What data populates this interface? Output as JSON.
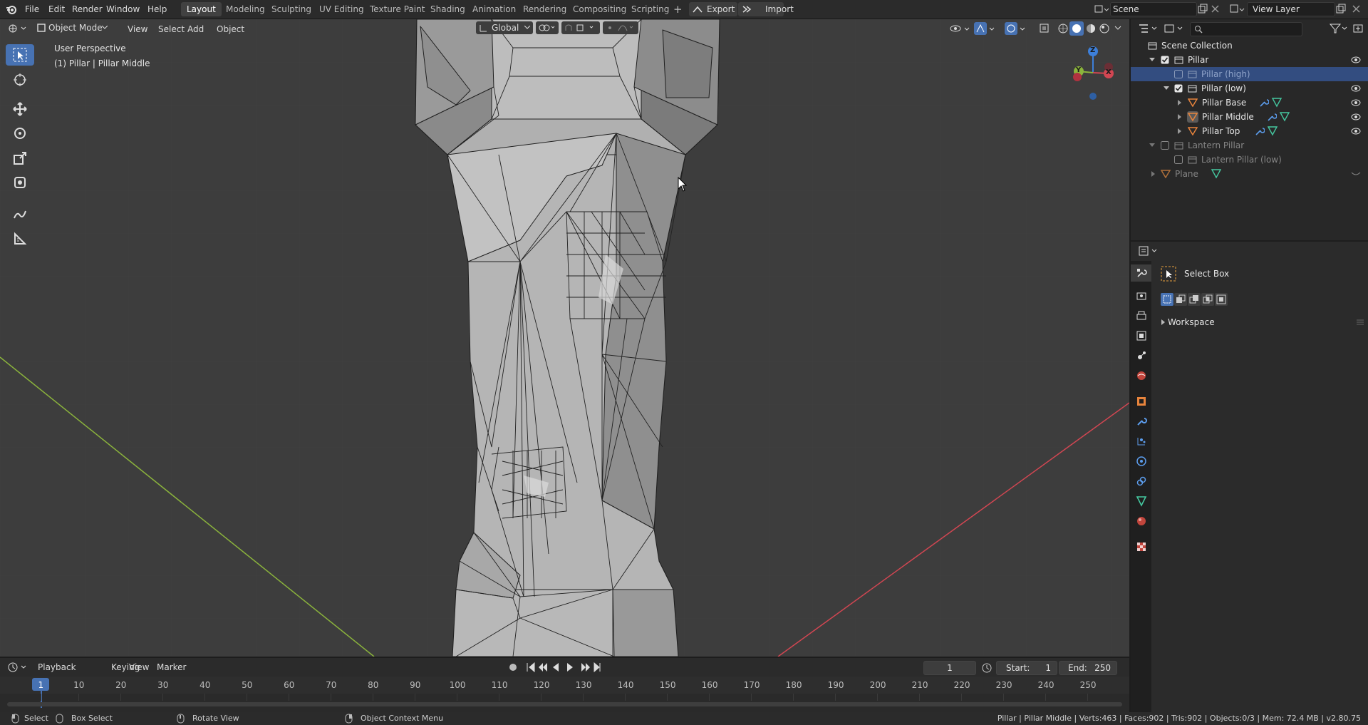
{
  "topbar": {
    "menus": [
      "File",
      "Edit",
      "Render",
      "Window",
      "Help"
    ],
    "workspaces": [
      "Layout",
      "Modeling",
      "Sculpting",
      "UV Editing",
      "Texture Paint",
      "Shading",
      "Animation",
      "Rendering",
      "Compositing",
      "Scripting"
    ],
    "add_tab": "+",
    "export_label": "Export",
    "import_label": "Import",
    "scene_name": "Scene",
    "view_layer": "View Layer"
  },
  "viewport": {
    "mode": "Object Mode",
    "menus": [
      "View",
      "Select",
      "Add",
      "Object"
    ],
    "orientation": "Global",
    "perspective_label": "User Perspective",
    "active_object_label": "(1) Pillar | Pillar Middle",
    "gizmo": {
      "z": "Z",
      "y": "Y",
      "x": "X"
    }
  },
  "timeline": {
    "menus": [
      "Playback",
      "Keying",
      "View",
      "Marker"
    ],
    "current_frame": "1",
    "start_label": "Start:",
    "start_value": "1",
    "end_label": "End:",
    "end_value": "250",
    "frame_marks": [
      "1",
      "10",
      "20",
      "30",
      "40",
      "50",
      "60",
      "70",
      "80",
      "90",
      "100",
      "110",
      "120",
      "130",
      "140",
      "150",
      "160",
      "170",
      "180",
      "190",
      "200",
      "210",
      "220",
      "230",
      "240",
      "250"
    ]
  },
  "statusbar": {
    "select": "Select",
    "box_select": "Box Select",
    "rotate_view": "Rotate View",
    "context_menu": "Object Context Menu",
    "stats": "Pillar | Pillar Middle | Verts:463 | Faces:902 | Tris:902 | Objects:0/3 | Mem: 72.4 MB | v2.80.75"
  },
  "outliner": {
    "search_placeholder": "",
    "root": "Scene Collection",
    "items": [
      {
        "label": "Pillar",
        "dim": false
      },
      {
        "label": "Pillar (high)",
        "dim": true
      },
      {
        "label": "Pillar (low)",
        "dim": false
      },
      {
        "label": "Pillar Base",
        "dim": false
      },
      {
        "label": "Pillar Middle",
        "dim": false
      },
      {
        "label": "Pillar Top",
        "dim": false
      },
      {
        "label": "Lantern Pillar",
        "dim": true
      },
      {
        "label": "Lantern Pillar (low)",
        "dim": true
      },
      {
        "label": "Plane",
        "dim": true
      }
    ]
  },
  "properties": {
    "tool_name": "Select Box",
    "panel": "Workspace"
  },
  "colors": {
    "accent": "#4772b3",
    "selection_row": "#334d80",
    "axis_x": "#d24652",
    "axis_y": "#8bb43c",
    "axis_z": "#3d7fd9",
    "viewport_bg": "#3d3d3d"
  }
}
